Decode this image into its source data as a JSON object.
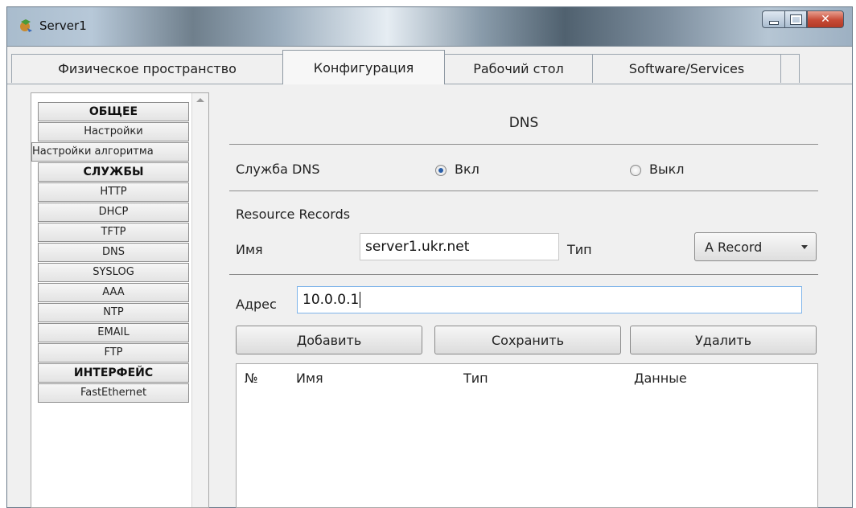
{
  "window": {
    "title": "Server1"
  },
  "tabs": [
    {
      "label": "Физическое пространство"
    },
    {
      "label": "Конфигурация"
    },
    {
      "label": "Рабочий стол"
    },
    {
      "label": "Software/Services"
    }
  ],
  "sidebar": {
    "items": [
      {
        "label": "ОБЩЕЕ",
        "kind": "header"
      },
      {
        "label": "Настройки",
        "kind": "item"
      },
      {
        "label": "Настройки алгоритма",
        "kind": "item"
      },
      {
        "label": "СЛУЖБЫ",
        "kind": "header"
      },
      {
        "label": "HTTP",
        "kind": "item"
      },
      {
        "label": "DHCP",
        "kind": "item"
      },
      {
        "label": "TFTP",
        "kind": "item"
      },
      {
        "label": "DNS",
        "kind": "item"
      },
      {
        "label": "SYSLOG",
        "kind": "item"
      },
      {
        "label": "AAA",
        "kind": "item"
      },
      {
        "label": "NTP",
        "kind": "item"
      },
      {
        "label": "EMAIL",
        "kind": "item"
      },
      {
        "label": "FTP",
        "kind": "item"
      },
      {
        "label": "ИНТЕРФЕЙС",
        "kind": "header"
      },
      {
        "label": "FastEthernet",
        "kind": "item"
      }
    ]
  },
  "dns": {
    "title": "DNS",
    "service_label": "Служба DNS",
    "on_label": "Вкл",
    "off_label": "Выкл",
    "service_on": true,
    "records_label": "Resource Records",
    "name_label": "Имя",
    "name_value": "server1.ukr.net",
    "type_label": "Тип",
    "type_value": "A Record",
    "address_label": "Адрес",
    "address_value": "10.0.0.1",
    "add_button": "Добавить",
    "save_button": "Сохранить",
    "delete_button": "Удалить",
    "table_headers": [
      "№",
      "Имя",
      "Тип",
      "Данные"
    ]
  },
  "colors": {
    "radio_selected": "#2a5fa8",
    "focus_border": "#7eb4ea"
  }
}
